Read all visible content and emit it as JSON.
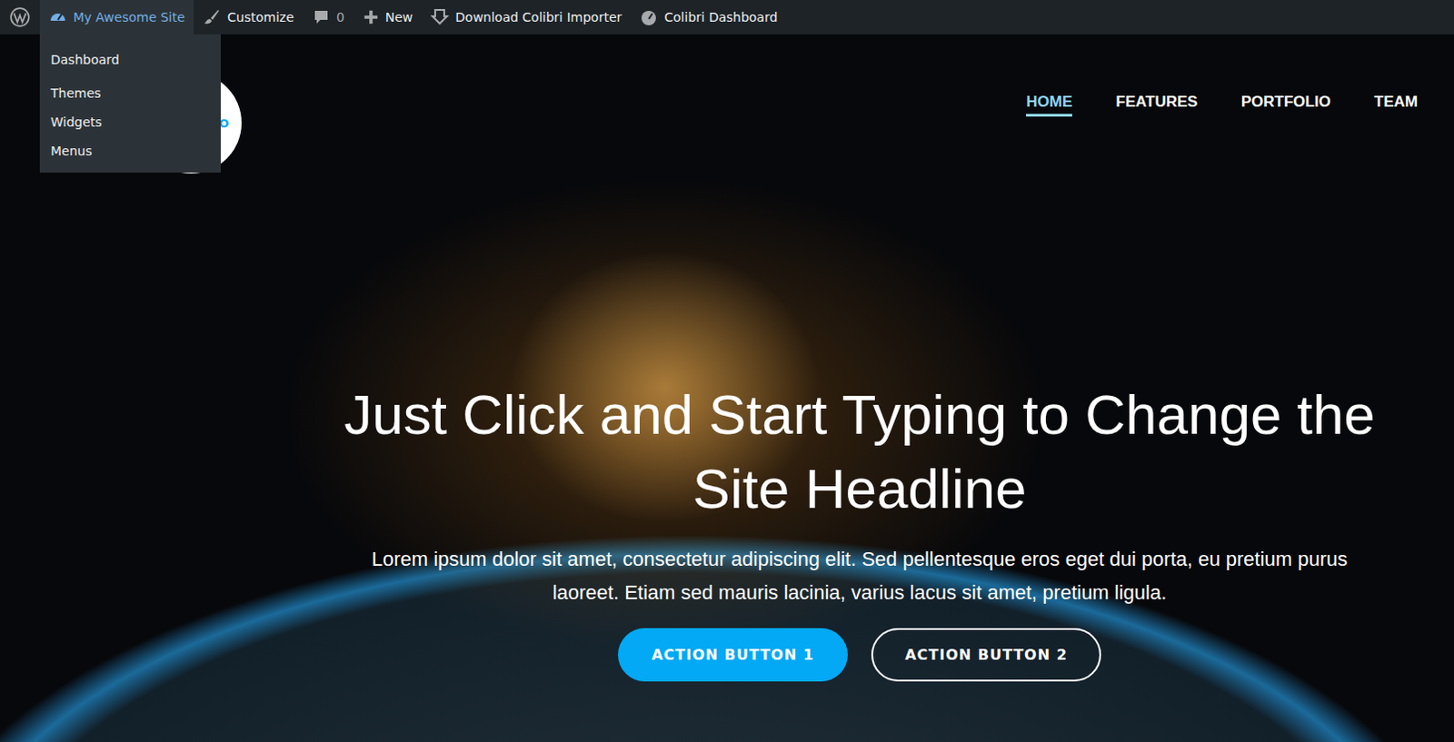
{
  "admin_bar": {
    "items": [
      {
        "label": "My Awesome Site",
        "kind": "site",
        "selected": true
      },
      {
        "label": "Customize",
        "kind": "customize",
        "selected": false
      },
      {
        "label": "0",
        "kind": "comments",
        "selected": false
      },
      {
        "label": "New",
        "kind": "new",
        "selected": false
      },
      {
        "label": "Download Colibri Importer",
        "kind": "importer",
        "selected": false
      },
      {
        "label": "Colibri Dashboard",
        "kind": "colibri",
        "selected": false
      }
    ]
  },
  "site_menu": {
    "items": [
      {
        "label": "Dashboard"
      },
      {
        "label": "Themes"
      },
      {
        "label": "Widgets"
      },
      {
        "label": "Menus"
      }
    ]
  },
  "logo": {
    "text": "GO"
  },
  "nav": {
    "items": [
      {
        "label": "HOME",
        "selected": true
      },
      {
        "label": "FEATURES",
        "selected": false
      },
      {
        "label": "PORTFOLIO",
        "selected": false
      },
      {
        "label": "TEAM",
        "selected": false
      }
    ]
  },
  "hero": {
    "title": "Just Click and Start Typing to Change the Site Headline",
    "text": "Lorem ipsum dolor sit amet, consectetur adipiscing elit. Sed pellentesque eros eget dui porta, eu pretium purus laoreet. Etiam sed mauris lacinia, varius lacus sit amet, pretium ligula.",
    "buttons": [
      {
        "label": "ACTION BUTTON 1",
        "kind": "primary"
      },
      {
        "label": "ACTION BUTTON 2",
        "kind": "outline"
      }
    ]
  }
}
